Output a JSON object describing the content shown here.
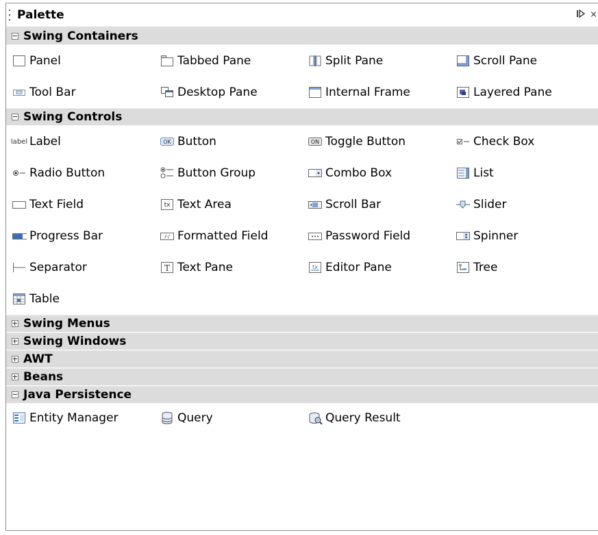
{
  "palette": {
    "title": "Palette",
    "close_glyph": "×"
  },
  "categories": {
    "swing_containers": {
      "label": "Swing Containers",
      "expanded": true,
      "items": [
        {
          "label": "Panel",
          "icon": "panel-icon"
        },
        {
          "label": "Tabbed Pane",
          "icon": "tabbed-pane-icon"
        },
        {
          "label": "Split Pane",
          "icon": "split-pane-icon"
        },
        {
          "label": "Scroll Pane",
          "icon": "scroll-pane-icon"
        },
        {
          "label": "Tool Bar",
          "icon": "tool-bar-icon"
        },
        {
          "label": "Desktop Pane",
          "icon": "desktop-pane-icon"
        },
        {
          "label": "Internal Frame",
          "icon": "internal-frame-icon"
        },
        {
          "label": "Layered Pane",
          "icon": "layered-pane-icon"
        }
      ]
    },
    "swing_controls": {
      "label": "Swing Controls",
      "expanded": true,
      "items": [
        {
          "label": "Label",
          "icon": "label-icon",
          "icon_text": "label"
        },
        {
          "label": "Button",
          "icon": "button-icon",
          "icon_text": "OK"
        },
        {
          "label": "Toggle Button",
          "icon": "toggle-button-icon",
          "icon_text": "ON"
        },
        {
          "label": "Check Box",
          "icon": "check-box-icon"
        },
        {
          "label": "Radio Button",
          "icon": "radio-button-icon"
        },
        {
          "label": "Button Group",
          "icon": "button-group-icon"
        },
        {
          "label": "Combo Box",
          "icon": "combo-box-icon"
        },
        {
          "label": "List",
          "icon": "list-icon"
        },
        {
          "label": "Text Field",
          "icon": "text-field-icon"
        },
        {
          "label": "Text Area",
          "icon": "text-area-icon",
          "icon_text": "tx"
        },
        {
          "label": "Scroll Bar",
          "icon": "scroll-bar-icon"
        },
        {
          "label": "Slider",
          "icon": "slider-icon"
        },
        {
          "label": "Progress Bar",
          "icon": "progress-bar-icon"
        },
        {
          "label": "Formatted Field",
          "icon": "formatted-field-icon",
          "icon_text": "/-/"
        },
        {
          "label": "Password Field",
          "icon": "password-field-icon",
          "icon_text": "•••"
        },
        {
          "label": "Spinner",
          "icon": "spinner-icon"
        },
        {
          "label": "Separator",
          "icon": "separator-icon"
        },
        {
          "label": "Text Pane",
          "icon": "text-pane-icon",
          "icon_text": "T"
        },
        {
          "label": "Editor Pane",
          "icon": "editor-pane-icon",
          "icon_text": "tx"
        },
        {
          "label": "Tree",
          "icon": "tree-icon"
        },
        {
          "label": "Table",
          "icon": "table-icon"
        }
      ]
    },
    "swing_menus": {
      "label": "Swing Menus",
      "expanded": false
    },
    "swing_windows": {
      "label": "Swing Windows",
      "expanded": false
    },
    "awt": {
      "label": "AWT",
      "expanded": false
    },
    "beans": {
      "label": "Beans",
      "expanded": false
    },
    "java_persistence": {
      "label": "Java Persistence",
      "expanded": true,
      "items": [
        {
          "label": "Entity Manager",
          "icon": "entity-manager-icon"
        },
        {
          "label": "Query",
          "icon": "query-icon"
        },
        {
          "label": "Query Result",
          "icon": "query-result-icon"
        }
      ]
    }
  }
}
